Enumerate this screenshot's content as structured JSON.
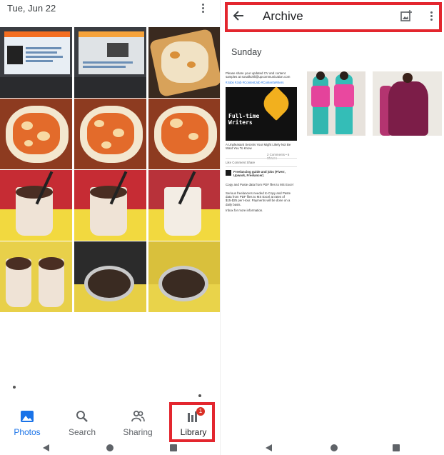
{
  "left_screen": {
    "header": {
      "date": "Tue, Jun 22",
      "more_icon": "more-vert-icon"
    },
    "grid": {
      "rows": 4,
      "cols": 3,
      "tiles": [
        "laptop-screen",
        "laptop-screen",
        "food-toast",
        "food-pizza",
        "food-pizza",
        "food-pizza",
        "drink-cup",
        "drink-cup",
        "drink-cup",
        "drink-cup",
        "drink-bowl",
        "drink-bowl"
      ]
    },
    "bottom_nav": {
      "items": [
        {
          "label": "Photos",
          "icon": "photo-icon",
          "active": true
        },
        {
          "label": "Search",
          "icon": "search-icon",
          "active": false
        },
        {
          "label": "Sharing",
          "icon": "people-icon",
          "active": false
        },
        {
          "label": "Library",
          "icon": "library-icon",
          "active": false,
          "badge": "1"
        }
      ]
    }
  },
  "right_screen": {
    "header": {
      "title": "Archive",
      "back_icon": "back-arrow-icon",
      "add_icon": "add-photo-icon",
      "more_icon": "more-vert-icon"
    },
    "section_label": "Sunday",
    "doc": {
      "intro": "Please share your updated CV and content samples at sonalkohli@upcommunication.com",
      "tags": "#Jobs #Job #ContentJob #ContentWriters",
      "poster_text": "Full-time Writers",
      "caption": "A Unpleasant Secrets Your Might Likely Not Be Want You To Know",
      "stats": "2 Comments • 6 Shares",
      "actions": "Like   Comment   Share",
      "group": "Freelancing guide and jobs (Fiverr, Upwork, Freelancer)",
      "post": "Copy and Paste data from PDF files to MS Excel",
      "post2": "Serious freelancers needed to Copy and Paste data from PDF files to MS Excel at rates of $15-$25 per Hour. Payments will be done on a daily basis.",
      "cta": "Inbox for more information."
    },
    "photos": [
      "women-suits-photo",
      "maroon-gown-photo"
    ]
  },
  "colors": {
    "highlight": "#e3262e",
    "accent": "#1a73e8",
    "badge": "#d93025"
  }
}
